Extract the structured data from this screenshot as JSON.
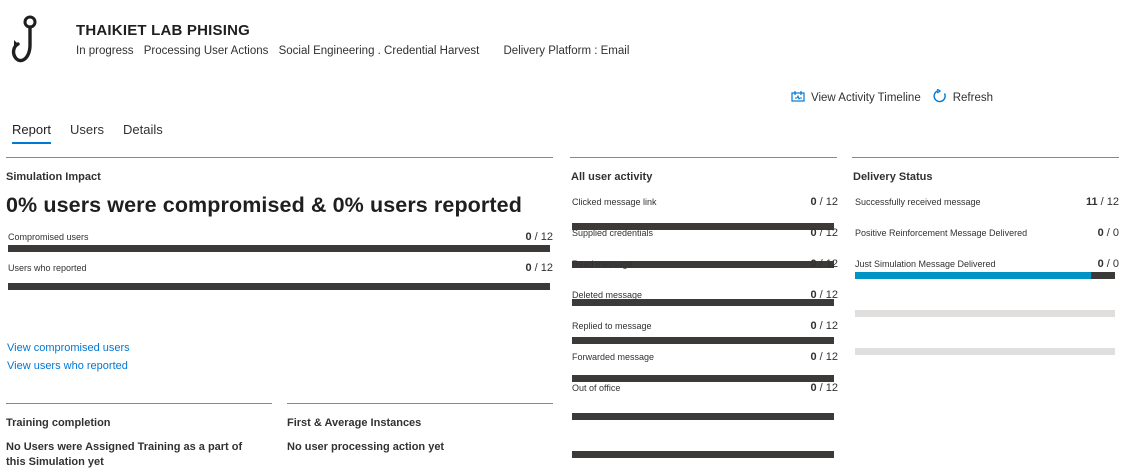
{
  "header": {
    "title": "THAIKIET LAB PHISING",
    "status": "In progress",
    "processing": "Processing User Actions",
    "technique": "Social Engineering . Credential Harvest",
    "delivery_platform": "Delivery Platform : Email",
    "icon": "fishhook-icon"
  },
  "actions": {
    "view_timeline": "View Activity Timeline",
    "refresh": "Refresh"
  },
  "tabs": [
    "Report",
    "Users",
    "Details"
  ],
  "active_tab": "Report",
  "simulation_impact": {
    "title": "Simulation Impact",
    "headline": "0% users were compromised & 0% users reported",
    "metrics": [
      {
        "label": "Compromised users",
        "value": "0",
        "total": "12"
      },
      {
        "label": "Users who reported",
        "value": "0",
        "total": "12"
      }
    ],
    "links": [
      "View compromised users",
      "View users who reported"
    ]
  },
  "training": {
    "title": "Training completion",
    "text": "No Users were Assigned Training as a part of this Simulation yet"
  },
  "instances": {
    "title": "First & Average Instances",
    "text": "No user processing action yet"
  },
  "user_activity": {
    "title": "All user activity",
    "metrics": [
      {
        "label": "Clicked message link",
        "value": "0",
        "total": "12"
      },
      {
        "label": "Supplied credentials",
        "value": "0",
        "total": "12"
      },
      {
        "label": "Read message",
        "value": "0",
        "total": "12"
      },
      {
        "label": "Deleted message",
        "value": "0",
        "total": "12"
      },
      {
        "label": "Replied to message",
        "value": "0",
        "total": "12"
      },
      {
        "label": "Forwarded message",
        "value": "0",
        "total": "12"
      },
      {
        "label": "Out of office",
        "value": "0",
        "total": "12"
      }
    ]
  },
  "delivery_status": {
    "title": "Delivery Status",
    "metrics": [
      {
        "label": "Successfully received message",
        "value": "11",
        "total": "12",
        "fraction": 0.9167
      },
      {
        "label": "Positive Reinforcement Message Delivered",
        "value": "0",
        "total": "0",
        "fraction": 0
      },
      {
        "label": "Just Simulation Message Delivered",
        "value": "0",
        "total": "0",
        "fraction": 0
      }
    ]
  },
  "colors": {
    "accent": "#0078d4",
    "bar_dark": "#3b3a39",
    "bar_fill": "#0093c5",
    "bar_empty": "#e1dfdd"
  }
}
